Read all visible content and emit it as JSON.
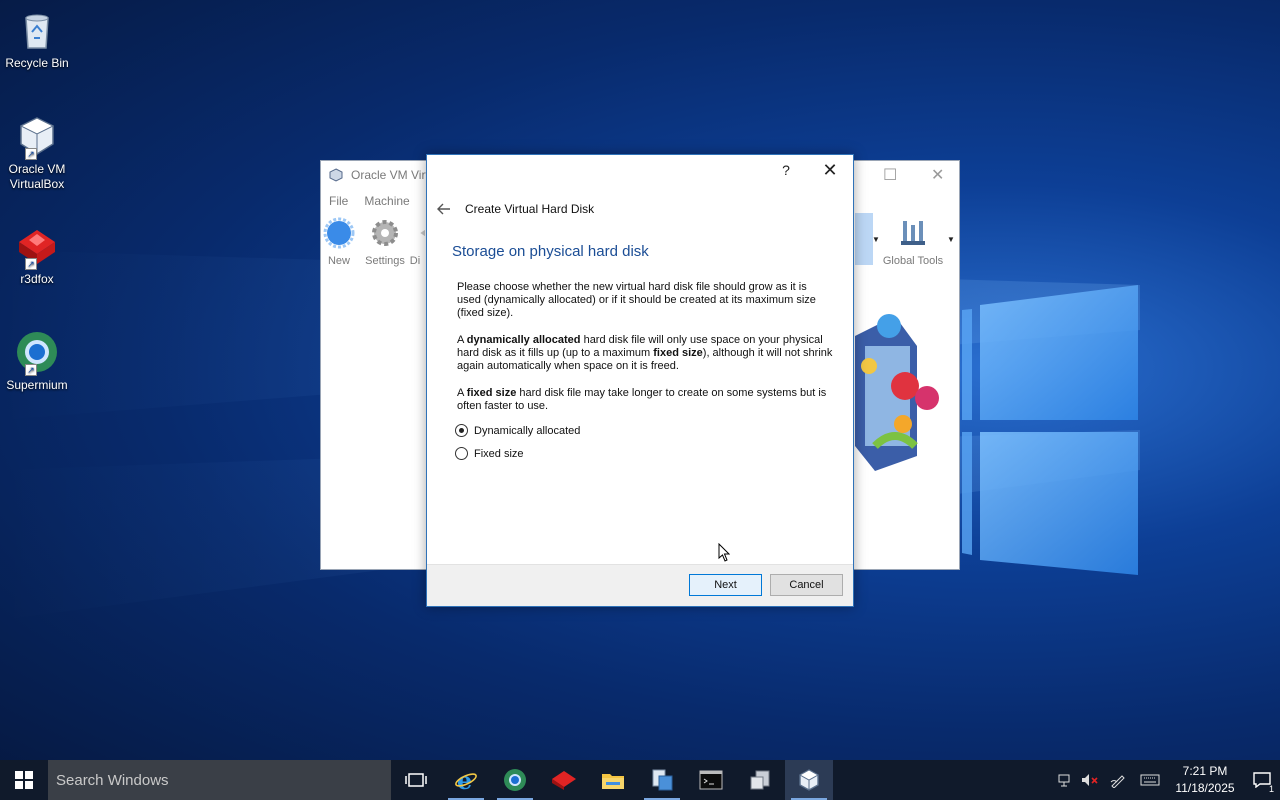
{
  "desktop": {
    "icons": [
      {
        "label": "Recycle Bin"
      },
      {
        "label": "Oracle VM VirtualBox"
      },
      {
        "label": "r3dfox"
      },
      {
        "label": "Supermium"
      }
    ]
  },
  "vbox_window": {
    "title": "Oracle VM Virt",
    "menu": [
      "File",
      "Machine"
    ],
    "tools": {
      "new": "New",
      "settings": "Settings",
      "discard": "Di",
      "snapshots_partial": "s",
      "global_tools": "Global Tools"
    }
  },
  "dialog": {
    "help_glyph": "?",
    "close_glyph": "✕",
    "wizard_title": "Create Virtual Hard Disk",
    "section_title": "Storage on physical hard disk",
    "para1": "Please choose whether the new virtual hard disk file should grow as it is used (dynamically allocated) or if it should be created at its maximum size (fixed size).",
    "para2_a": "A ",
    "para2_b": "dynamically allocated",
    "para2_c": " hard disk file will only use space on your physical hard disk as it fills up (up to a maximum ",
    "para2_d": "fixed size",
    "para2_e": "), although it will not shrink again automatically when space on it is freed.",
    "para3_a": "A ",
    "para3_b": "fixed size",
    "para3_c": " hard disk file may take longer to create on some systems but is often faster to use.",
    "options": [
      {
        "label": "Dynamically allocated",
        "selected": true
      },
      {
        "label": "Fixed size",
        "selected": false
      }
    ],
    "next_label": "Next",
    "cancel_label": "Cancel"
  },
  "taskbar": {
    "search_placeholder": "Search Windows",
    "apps": [
      "task-view",
      "internet-explorer",
      "supermium",
      "r3dfox",
      "file-explorer",
      "file-manager",
      "command-prompt",
      "virtual-machine-manager",
      "virtualbox"
    ],
    "time": "7:21 PM",
    "date": "11/18/2025",
    "notification_count": "1"
  },
  "colors": {
    "accent": "#0078d7",
    "section_title": "#1b4d95"
  }
}
